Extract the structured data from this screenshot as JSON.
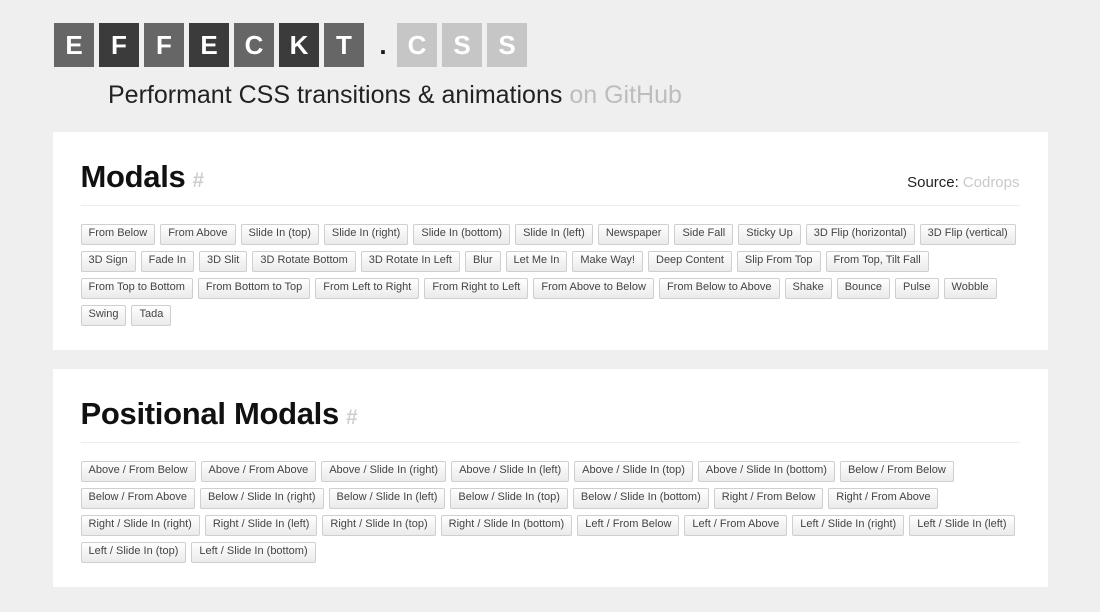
{
  "header": {
    "logo_tiles": [
      {
        "char": "E",
        "shade": "mid"
      },
      {
        "char": "F",
        "shade": "dark"
      },
      {
        "char": "F",
        "shade": "mid"
      },
      {
        "char": "E",
        "shade": "dark"
      },
      {
        "char": "C",
        "shade": "mid"
      },
      {
        "char": "K",
        "shade": "dark"
      },
      {
        "char": "T",
        "shade": "mid"
      }
    ],
    "dot": ".",
    "logo_tiles_ext": [
      {
        "char": "C",
        "shade": "light"
      },
      {
        "char": "S",
        "shade": "light"
      },
      {
        "char": "S",
        "shade": "light"
      }
    ],
    "tagline_main": "Performant CSS transitions & animations",
    "tagline_muted": "on GitHub",
    "colors": {
      "tile_dark": "#3b3b3b",
      "tile_mid": "#666666",
      "tile_light": "#c6c6c6",
      "page_bg": "#efefef",
      "card_bg": "#ffffff"
    }
  },
  "sections": [
    {
      "title": "Modals",
      "anchor": "#",
      "source_label": "Source:",
      "source_link": "Codrops",
      "buttons": [
        "From Below",
        "From Above",
        "Slide In (top)",
        "Slide In (right)",
        "Slide In (bottom)",
        "Slide In (left)",
        "Newspaper",
        "Side Fall",
        "Sticky Up",
        "3D Flip (horizontal)",
        "3D Flip (vertical)",
        "3D Sign",
        "Fade In",
        "3D Slit",
        "3D Rotate Bottom",
        "3D Rotate In Left",
        "Blur",
        "Let Me In",
        "Make Way!",
        "Deep Content",
        "Slip From Top",
        "From Top, Tilt Fall",
        "From Top to Bottom",
        "From Bottom to Top",
        "From Left to Right",
        "From Right to Left",
        "From Above to Below",
        "From Below to Above",
        "Shake",
        "Bounce",
        "Pulse",
        "Wobble",
        "Swing",
        "Tada"
      ]
    },
    {
      "title": "Positional Modals",
      "anchor": "#",
      "source_label": "",
      "source_link": "",
      "buttons": [
        "Above / From Below",
        "Above / From Above",
        "Above / Slide In (right)",
        "Above / Slide In (left)",
        "Above / Slide In (top)",
        "Above / Slide In (bottom)",
        "Below / From Below",
        "Below / From Above",
        "Below / Slide In (right)",
        "Below / Slide In (left)",
        "Below / Slide In (top)",
        "Below / Slide In (bottom)",
        "Right / From Below",
        "Right / From Above",
        "Right / Slide In (right)",
        "Right / Slide In (left)",
        "Right / Slide In (top)",
        "Right / Slide In (bottom)",
        "Left / From Below",
        "Left / From Above",
        "Left / Slide In (right)",
        "Left / Slide In (left)",
        "Left / Slide In (top)",
        "Left / Slide In (bottom)"
      ]
    }
  ]
}
